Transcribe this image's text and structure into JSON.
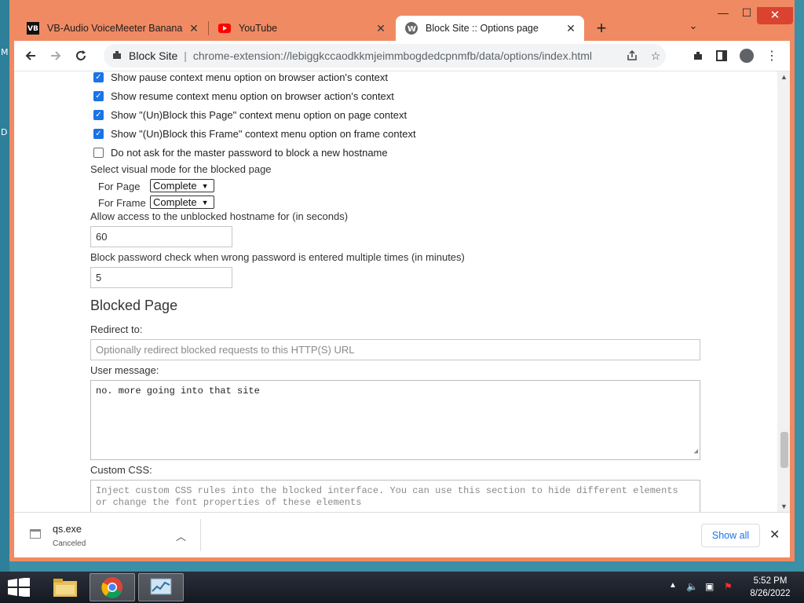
{
  "desktop": {
    "edge_labels": [
      "M",
      "D"
    ]
  },
  "window": {
    "tabs": [
      {
        "title": "VB-Audio VoiceMeeter Banana",
        "icon": "vb-audio-icon",
        "active": false
      },
      {
        "title": "YouTube",
        "icon": "youtube-icon",
        "active": false
      },
      {
        "title": "Block Site :: Options page",
        "icon": "block-site-icon",
        "active": true
      }
    ],
    "controls": {
      "minimize": "—",
      "maximize": "☐",
      "close": "✕"
    }
  },
  "toolbar": {
    "site_name": "Block Site",
    "url": "chrome-extension://lebiggkccaodkkmjeimmbogdedcpnmfb/data/options/index.html"
  },
  "options": {
    "checkboxes": [
      {
        "label": "Show pause context menu option on browser action's context",
        "checked": true
      },
      {
        "label": "Show resume context menu option on browser action's context",
        "checked": true
      },
      {
        "label": "Show \"(Un)Block this Page\" context menu option on page context",
        "checked": true
      },
      {
        "label": "Show \"(Un)Block this Frame\" context menu option on frame context",
        "checked": true
      },
      {
        "label": "Do not ask for the master password to block a new hostname",
        "checked": false
      }
    ],
    "visual_mode_label": "Select visual mode for the blocked page",
    "for_page_label": "For Page",
    "for_page_value": "Complete",
    "for_frame_label": "For Frame",
    "for_frame_value": "Complete",
    "allow_access_label": "Allow access to the unblocked hostname for (in seconds)",
    "allow_access_value": "60",
    "block_password_label": "Block password check when wrong password is entered multiple times (in minutes)",
    "block_password_value": "5"
  },
  "blocked_page": {
    "heading": "Blocked Page",
    "redirect_label": "Redirect to:",
    "redirect_placeholder": "Optionally redirect blocked requests to this HTTP(S) URL",
    "user_message_label": "User message:",
    "user_message_value": "no. more going into that site",
    "custom_css_label": "Custom CSS:",
    "custom_css_placeholder": "Inject custom CSS rules into the blocked interface. You can use this section to hide different elements or change the font properties of these elements"
  },
  "download_shelf": {
    "file_name": "qs.exe",
    "status": "Canceled",
    "show_all": "Show all"
  },
  "taskbar": {
    "time": "5:52 PM",
    "date": "8/26/2022"
  },
  "colors": {
    "accent": "#1a73e8",
    "window_frame": "#f08a62",
    "close_button": "#d9432f"
  }
}
